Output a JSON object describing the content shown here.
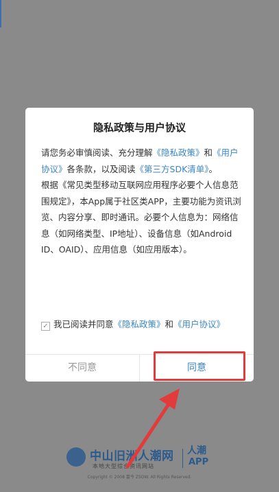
{
  "dialog": {
    "title": "隐私政策与用户协议",
    "para1": {
      "t1": "请您务必审慎阅读、充分理解",
      "link_privacy": "《隐私政策》",
      "t2": "和",
      "link_user_agreement": "《用户协议》",
      "t3": "各条款，以及阅读",
      "link_sdk": "《第三方SDK清单》",
      "t4": "。"
    },
    "para2": "根据《常见类型移动互联网应用程序必要个人信息范围规定》，本App属于社区类APP，主要功能为资讯浏览、内容分享、即时通讯。必要个人信息为：网络信息（如网络类型、IP地址）、设备信息（如Android ID、OAID）、应用信息（如应用版本）。",
    "agree_row": {
      "checkmark": "✓",
      "t1": "我已阅读并同意",
      "link_privacy": "《隐私政策》",
      "t2": "和",
      "link_user_agreement": "《用户协议》"
    },
    "buttons": {
      "disagree": "不同意",
      "agree": "同意"
    }
  },
  "footer": {
    "logo_text": "中山旧洲人潮网",
    "logo_sub": "本地大型综合资讯网站",
    "app_name": "人潮",
    "app_tag": "APP",
    "copyright": "Copyright © 2008 富今 ZSOW. All Rights Reserved."
  },
  "colors": {
    "overlay": "#8a8a8a",
    "link": "#3a86c8",
    "highlight": "#e23b3b",
    "brand": "#2b5a8c"
  }
}
